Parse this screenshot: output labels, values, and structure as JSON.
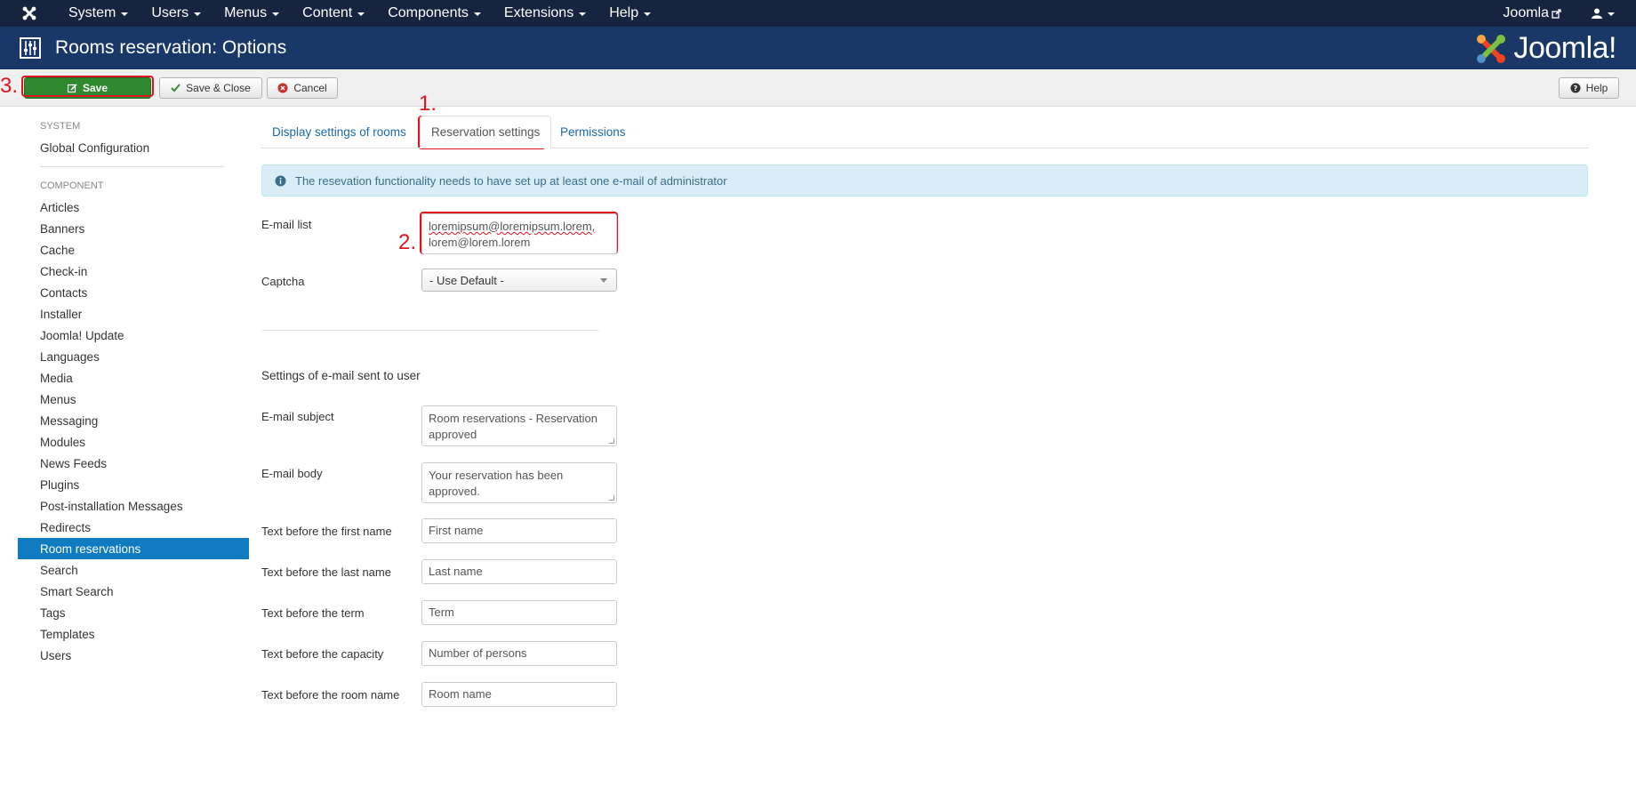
{
  "topnav": {
    "menu": [
      "System",
      "Users",
      "Menus",
      "Content",
      "Components",
      "Extensions",
      "Help"
    ],
    "site_link": "Joomla",
    "icons": {
      "logo": "joomla-logo-icon",
      "external": "external-link-icon",
      "user": "user-icon"
    }
  },
  "header": {
    "title": "Rooms reservation: Options",
    "brand": "Joomla!"
  },
  "toolbar": {
    "save_label": "Save",
    "save_close_label": "Save & Close",
    "cancel_label": "Cancel",
    "help_label": "Help"
  },
  "annotations": {
    "one": "1.",
    "two": "2.",
    "three": "3."
  },
  "sidebar": {
    "system_heading": "SYSTEM",
    "global_config": "Global Configuration",
    "component_heading": "COMPONENT",
    "items": [
      "Articles",
      "Banners",
      "Cache",
      "Check-in",
      "Contacts",
      "Installer",
      "Joomla! Update",
      "Languages",
      "Media",
      "Menus",
      "Messaging",
      "Modules",
      "News Feeds",
      "Plugins",
      "Post-installation Messages",
      "Redirects",
      "Room reservations",
      "Search",
      "Smart Search",
      "Tags",
      "Templates",
      "Users"
    ],
    "active": "Room reservations"
  },
  "tabs": [
    "Display settings of rooms",
    "Reservation settings",
    "Permissions"
  ],
  "alert": "The resevation functionality needs to have set up at least one e-mail of administrator",
  "form": {
    "email_list_label": "E-mail list",
    "email_list_line1": "loremipsum@loremipsum.lorem,",
    "email_list_line2": "lorem@lorem.lorem",
    "captcha_label": "Captcha",
    "captcha_value": "- Use Default -",
    "section_title": "Settings of e-mail sent to user",
    "subject_label": "E-mail subject",
    "subject_value": "Room reservations - Reservation approved",
    "body_label": "E-mail body",
    "body_value": "Your reservation has been approved.",
    "first_name_label": "Text before the first name",
    "first_name_value": "First name",
    "last_name_label": "Text before the last name",
    "last_name_value": "Last name",
    "term_label": "Text before the term",
    "term_value": "Term",
    "capacity_label": "Text before the capacity",
    "capacity_value": "Number of persons",
    "room_label": "Text before the room name",
    "room_value": "Room name"
  },
  "colors": {
    "navbar": "#17243f",
    "header": "#1a3867",
    "save": "#2f8a2f",
    "active": "#0f7cc2",
    "annotation": "#e0141e"
  }
}
